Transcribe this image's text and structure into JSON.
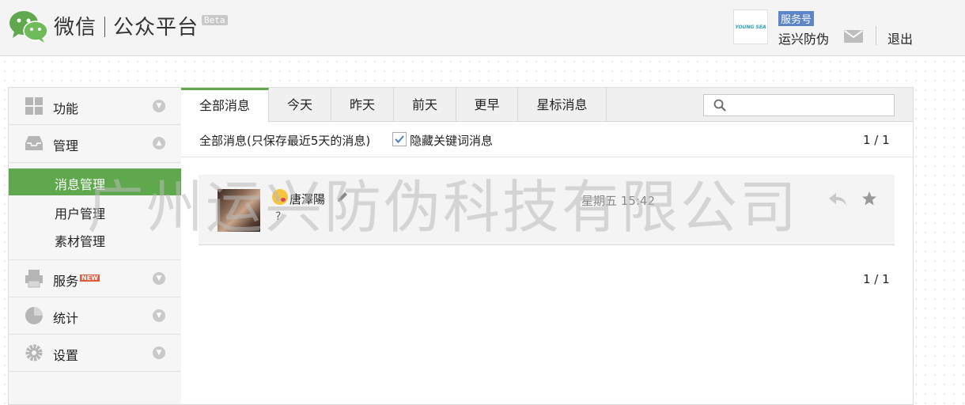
{
  "header": {
    "logo_text": "微信",
    "product_name": "公众平台",
    "beta_label": "Beta",
    "account_logo_text": "YOUNG SEA",
    "account_type": "服务号",
    "account_name": "运兴防伪",
    "logout_label": "退出"
  },
  "sidebar": {
    "sections": [
      {
        "label": "功能",
        "icon": "grid-icon"
      },
      {
        "label": "管理",
        "icon": "inbox-icon"
      },
      {
        "label": "服务",
        "icon": "printer-icon",
        "badge": "NEW"
      },
      {
        "label": "统计",
        "icon": "pie-chart-icon"
      },
      {
        "label": "设置",
        "icon": "gear-icon"
      }
    ],
    "manage_items": [
      {
        "label": "消息管理",
        "active": true
      },
      {
        "label": "用户管理"
      },
      {
        "label": "素材管理"
      }
    ]
  },
  "tabs": [
    {
      "label": "全部消息",
      "active": true
    },
    {
      "label": "今天"
    },
    {
      "label": "昨天"
    },
    {
      "label": "前天"
    },
    {
      "label": "更早"
    },
    {
      "label": "星标消息"
    }
  ],
  "search": {
    "placeholder": ""
  },
  "filter": {
    "description": "全部消息(只保存最近5天的消息)",
    "hide_keyword_label": "隐藏关键词消息",
    "hide_keyword_checked": true
  },
  "pagination": {
    "top": "1 / 1",
    "bottom": "1 / 1"
  },
  "messages": [
    {
      "sender": "唐澤陽",
      "content": "?",
      "time": "星期五 15:42"
    }
  ],
  "watermark": "广州运兴防伪科技有限公司",
  "colors": {
    "accent": "#5fa84e",
    "badge_blue": "#5d86c8",
    "new_badge": "#e25b3a"
  }
}
